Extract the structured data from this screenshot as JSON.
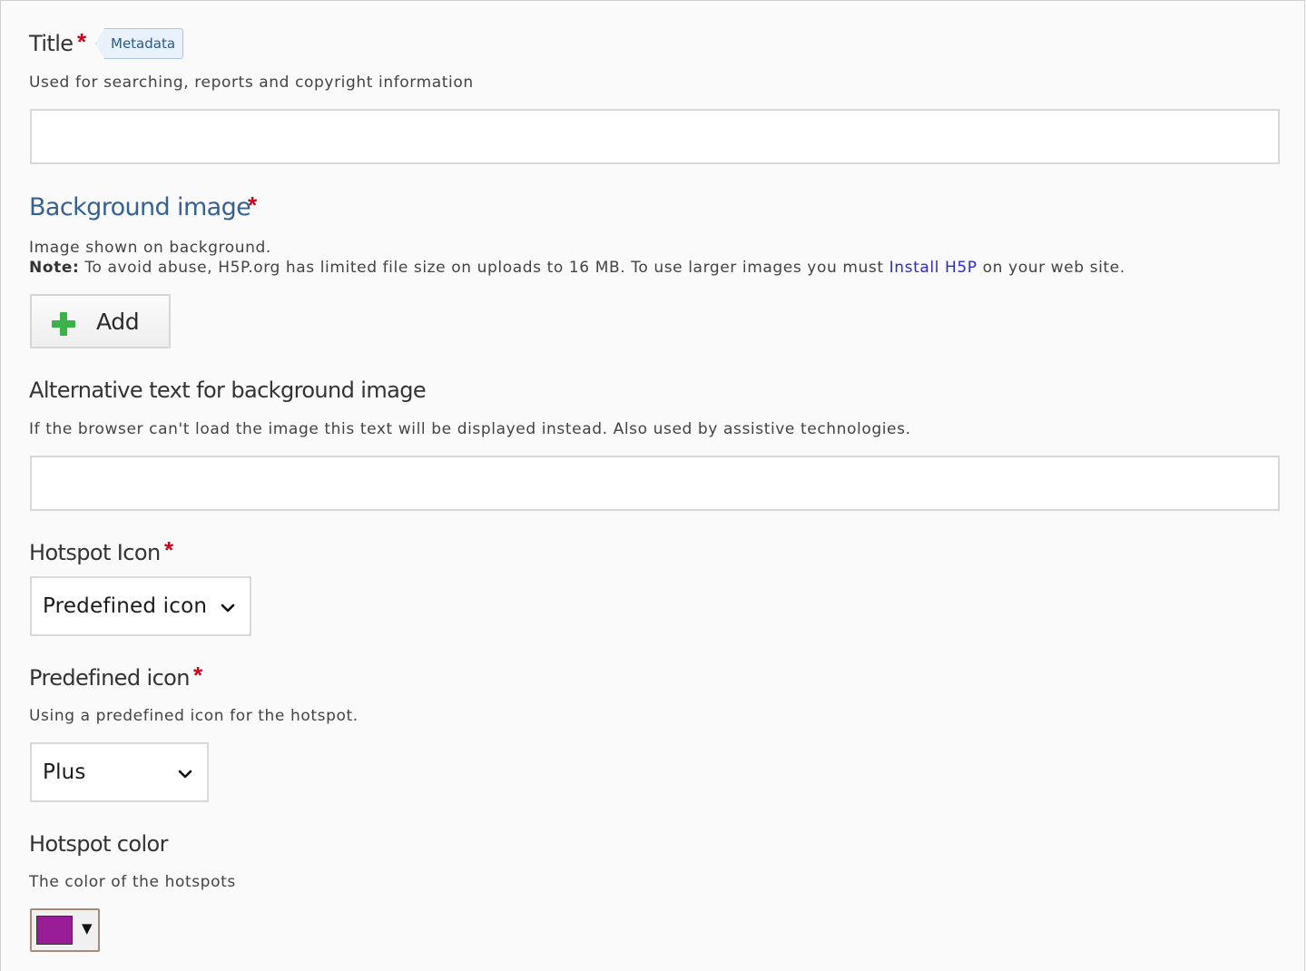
{
  "title_field": {
    "label": "Title",
    "required_mark": "*",
    "metadata_button": "Metadata",
    "description": "Used for searching, reports and copyright information",
    "value": ""
  },
  "background_image": {
    "label": "Background image",
    "required_mark": "*",
    "description": "Image shown on background.",
    "note_label": "Note:",
    "note_text": "To avoid abuse, H5P.org has limited file size on uploads to 16 MB. To use larger images you must",
    "note_link": "Install H5P",
    "note_suffix": "on your web site.",
    "add_button": "Add",
    "add_icon": "plus-icon"
  },
  "alt_text": {
    "label": "Alternative text for background image",
    "description": "If the browser can't load the image this text will be displayed instead. Also used by assistive technologies.",
    "value": ""
  },
  "hotspot_icon": {
    "label": "Hotspot Icon",
    "required_mark": "*",
    "selected": "Predefined icon"
  },
  "predefined_icon": {
    "label": "Predefined icon",
    "required_mark": "*",
    "description": "Using a predefined icon for the hotspot.",
    "selected": "Plus"
  },
  "hotspot_color": {
    "label": "Hotspot color",
    "description": "The color of the hotspots",
    "value": "#981d97",
    "arrow": "▼"
  },
  "colors": {
    "required": "#d0021b",
    "section_heading": "#366192",
    "link": "#2a2acd",
    "add_icon": "#3bb24a"
  }
}
